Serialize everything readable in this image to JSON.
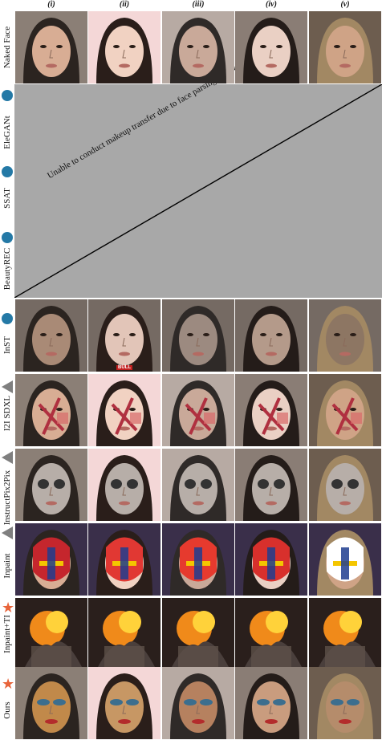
{
  "columns": [
    "(i)",
    "(ii)",
    "(iii)",
    "(iv)",
    "(v)"
  ],
  "rows": [
    {
      "label": "Naked Face",
      "marker": "none"
    },
    {
      "label": "EleGANt",
      "marker": "circle"
    },
    {
      "label": "SSAT",
      "marker": "circle"
    },
    {
      "label": "BeautyREC",
      "marker": "circle"
    },
    {
      "label": "InST",
      "marker": "circle"
    },
    {
      "label": "I2I SDXL",
      "marker": "triangle"
    },
    {
      "label": "InstructPix2Pix",
      "marker": "triangle"
    },
    {
      "label": "Inpaint",
      "marker": "triangle"
    },
    {
      "label": "Inpaint+TI",
      "marker": "star"
    },
    {
      "label": "Ours",
      "marker": "star"
    }
  ],
  "failure_note": "Unable to conduct makeup transfer due to face parsing failure",
  "cell_text": {
    "bull_label": "BULL"
  },
  "colors": {
    "circle": "#2479a6",
    "triangle": "#7f7f7f",
    "star": "#e8643a",
    "failure_bg": "#a8a8a8"
  }
}
